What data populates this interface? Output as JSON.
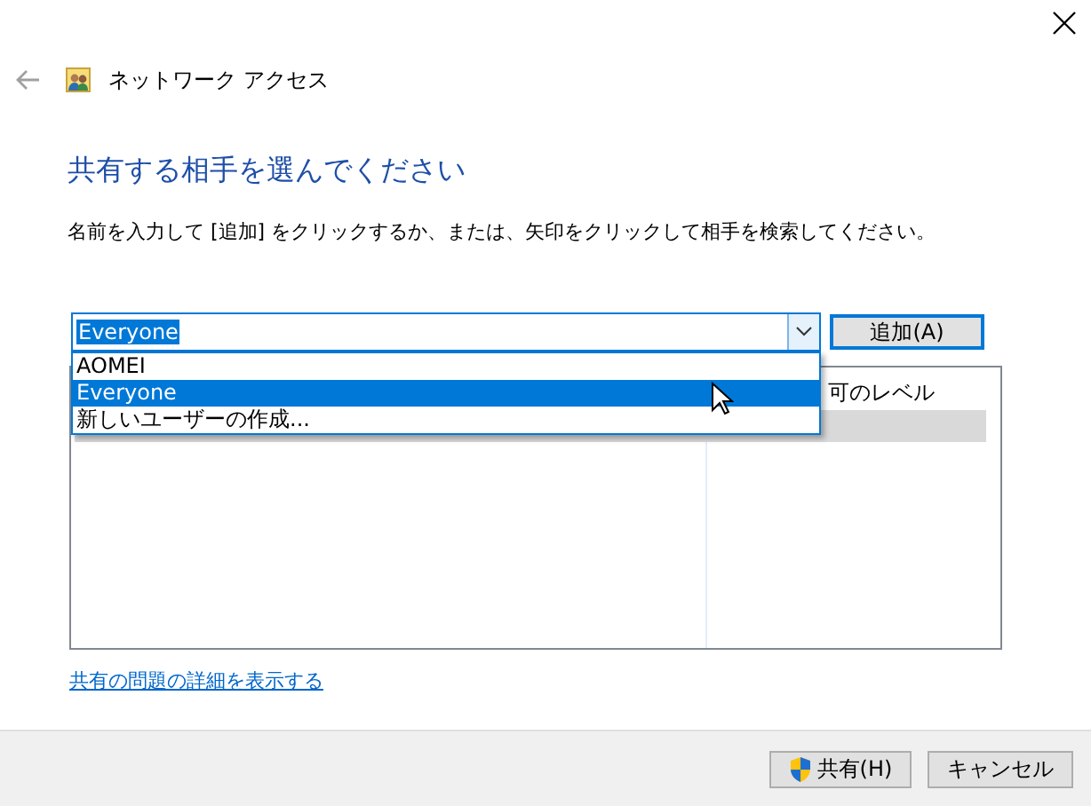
{
  "window": {
    "title": "ネットワーク アクセス"
  },
  "heading": "共有する相手を選んでください",
  "instruction": "名前を入力して [追加] をクリックするか、または、矢印をクリックして相手を検索してください。",
  "name_combo": {
    "value": "Everyone",
    "expanded": true,
    "options": [
      {
        "label": "AOMEI",
        "selected": false
      },
      {
        "label": "Everyone",
        "selected": true
      },
      {
        "label": "新しいユーザーの作成...",
        "selected": false
      }
    ]
  },
  "add_button": "追加(A)",
  "permission_list": {
    "column_2": "可のレベル",
    "rows": [
      {
        "selected": true
      }
    ]
  },
  "details_link": "共有の問題の詳細を表示する",
  "buttons": [
    {
      "label": "共有(H)",
      "kind": "shield"
    },
    {
      "label": "キャンセル",
      "kind": "plain"
    }
  ]
}
